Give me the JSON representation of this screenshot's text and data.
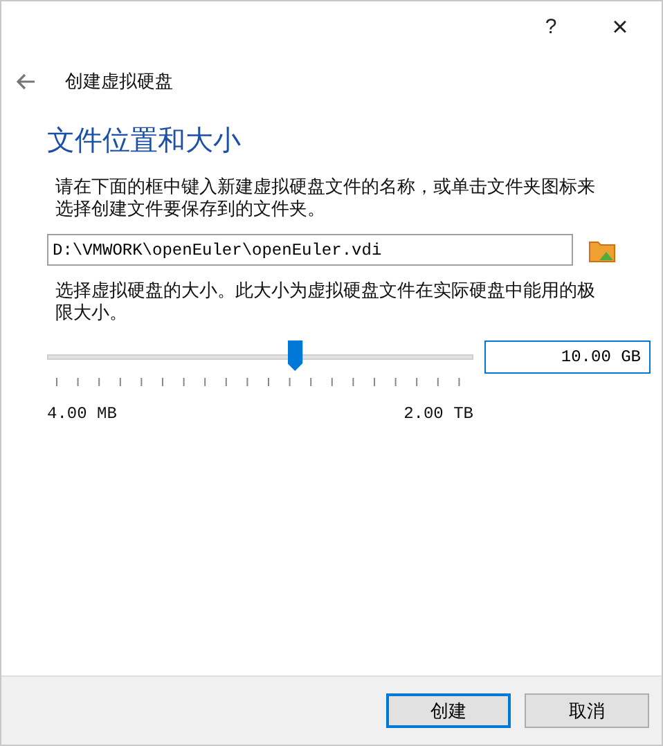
{
  "title_bar": {
    "help": "?",
    "close": "×"
  },
  "header": {
    "title": "创建虚拟硬盘"
  },
  "section_title": "文件位置和大小",
  "location": {
    "description": "请在下面的框中键入新建虚拟硬盘文件的名称，或单击文件夹图标来选择创建文件要保存到的文件夹。",
    "value": "D:\\VMWORK\\openEuler\\openEuler.vdi"
  },
  "size": {
    "description": "选择虚拟硬盘的大小。此大小为虚拟硬盘文件在实际硬盘中能用的极限大小。",
    "level": 0.58,
    "min_label": "4.00 MB",
    "max_label": "2.00 TB",
    "value": "10.00 GB"
  },
  "buttons": [
    {
      "label": "创建",
      "kind": "default"
    },
    {
      "label": "取消",
      "kind": "normal"
    }
  ]
}
